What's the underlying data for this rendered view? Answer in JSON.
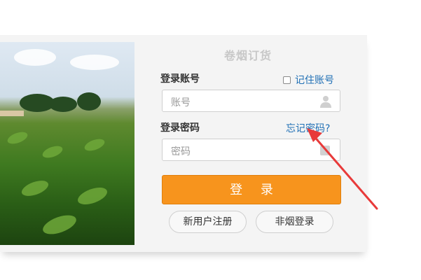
{
  "header": {
    "title": "卷烟订货"
  },
  "account": {
    "label": "登录账号",
    "remember_label": "记住账号",
    "placeholder": "账号"
  },
  "password": {
    "label": "登录密码",
    "forgot_label": "忘记密码?",
    "placeholder": "密码"
  },
  "actions": {
    "login_label": "登 录",
    "register_label": "新用户注册",
    "non_tobacco_label": "非烟登录"
  },
  "colors": {
    "accent": "#f7941d",
    "link": "#1f6fb5",
    "annotation_arrow": "#e83a3a"
  },
  "icons": {
    "user": "user-icon",
    "lock": "lock-icon",
    "checkbox": "checkbox-unchecked"
  }
}
